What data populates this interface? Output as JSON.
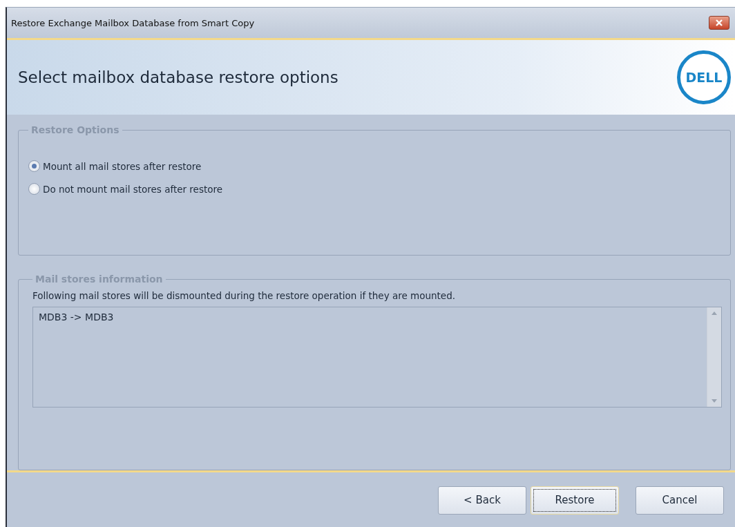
{
  "window": {
    "title": "Restore Exchange Mailbox Database from Smart Copy"
  },
  "header": {
    "title": "Select mailbox database restore options",
    "logo": "DELL"
  },
  "restore_options": {
    "legend": "Restore Options",
    "options": [
      {
        "label": "Mount all mail stores after restore",
        "selected": true
      },
      {
        "label": "Do not mount mail stores after restore",
        "selected": false
      }
    ]
  },
  "mail_stores": {
    "legend": "Mail stores information",
    "description": "Following mail stores will be dismounted during the restore operation if they are mounted.",
    "items": [
      "MDB3 -> MDB3"
    ]
  },
  "buttons": [
    {
      "label": "< Back",
      "focused": false
    },
    {
      "label": "Restore",
      "focused": true
    },
    {
      "label": "Cancel",
      "focused": false
    }
  ]
}
